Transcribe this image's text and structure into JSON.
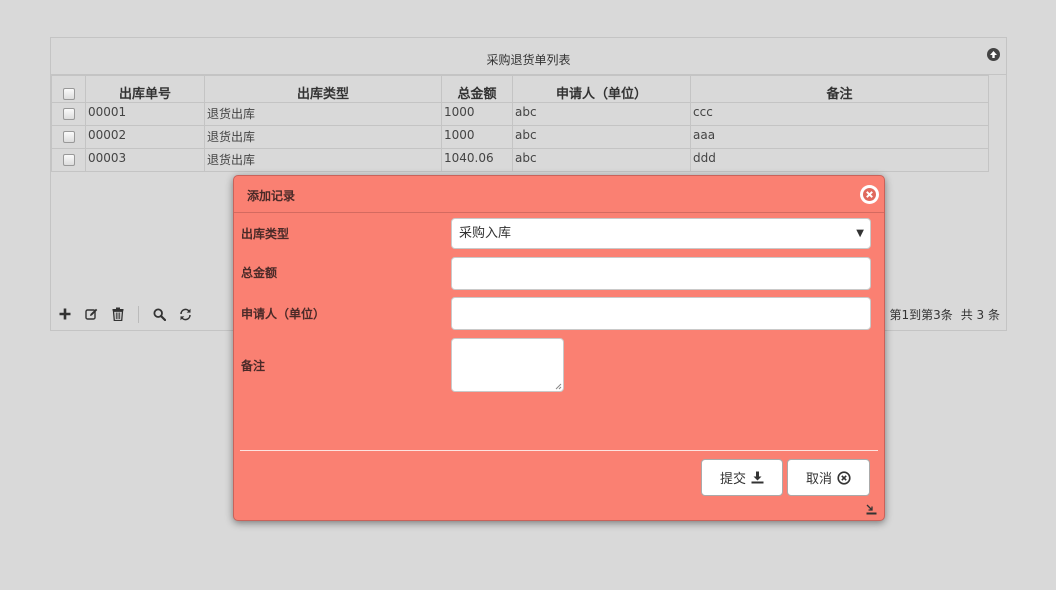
{
  "grid": {
    "caption": "采购退货单列表",
    "columns": [
      "出库单号",
      "出库类型",
      "总金额",
      "申请人（单位）",
      "备注"
    ],
    "rows": [
      {
        "no": "00001",
        "type": "退货出库",
        "amount": "1000",
        "applicant": "abc",
        "note": "ccc"
      },
      {
        "no": "00002",
        "type": "退货出库",
        "amount": "1000",
        "applicant": "abc",
        "note": "aaa"
      },
      {
        "no": "00003",
        "type": "退货出库",
        "amount": "1040.06",
        "applicant": "abc",
        "note": "ddd"
      }
    ],
    "pager": {
      "range": "第1到第3条",
      "total": "共 3 条"
    }
  },
  "dialog": {
    "title": "添加记录",
    "fields": {
      "type_label": "出库类型",
      "type_value": "采购入库",
      "amount_label": "总金额",
      "amount_value": "",
      "applicant_label": "申请人（单位）",
      "applicant_value": "",
      "note_label": "备注",
      "note_value": ""
    },
    "submit_label": "提交",
    "cancel_label": "取消"
  },
  "icons": {
    "collapse": "arrow-up-circle-icon",
    "add": "plus-icon",
    "edit": "edit-icon",
    "delete": "trash-icon",
    "search": "search-icon",
    "refresh": "refresh-icon",
    "close": "close-circle-icon",
    "submit": "download-icon",
    "cancel": "close-circle-icon",
    "resize": "resize-icon"
  },
  "colors": {
    "background": "#d9d9d9",
    "dialog": "#fa8072",
    "border": "#c4c4c4"
  }
}
